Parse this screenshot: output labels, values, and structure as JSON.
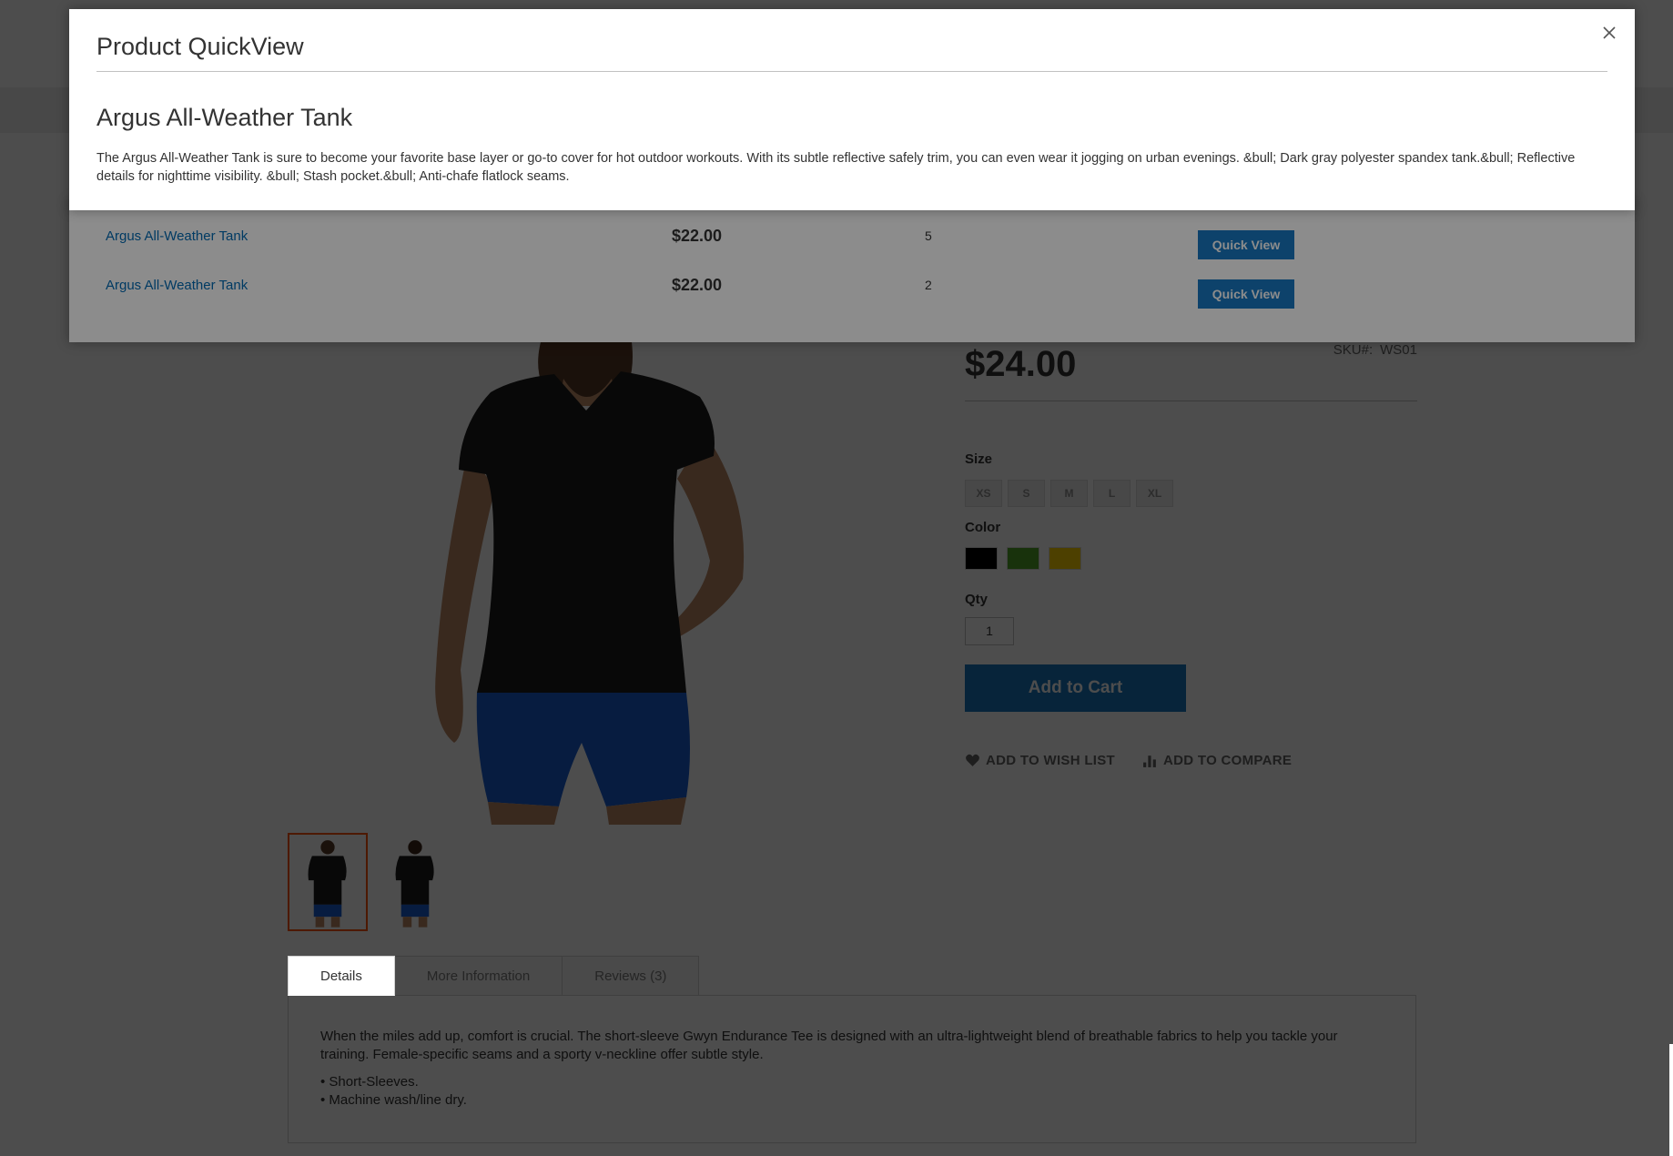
{
  "quickview": {
    "title": "Product QuickView",
    "product_name": "Argus All-Weather Tank",
    "description": "The Argus All-Weather Tank is sure to become your favorite base layer or go-to cover for hot outdoor workouts. With its subtle reflective safely trim, you can even wear it jogging on urban evenings. &bull; Dark gray polyester spandex tank.&bull; Reflective details for nighttime visibility. &bull; Stash pocket.&bull; Anti-chafe flatlock seams."
  },
  "related": {
    "rows": [
      {
        "name": "Argus All-Weather Tank",
        "price": "$22.00",
        "qty": "5",
        "button_label": "Quick View"
      },
      {
        "name": "Argus All-Weather Tank",
        "price": "$22.00",
        "qty": "2",
        "button_label": "Quick View"
      }
    ]
  },
  "product": {
    "price": "$24.00",
    "sku_label": "SKU#:",
    "sku_value": "WS01",
    "size_label": "Size",
    "sizes": [
      "XS",
      "S",
      "M",
      "L",
      "XL"
    ],
    "color_label": "Color",
    "colors": [
      "#000000",
      "#53a828",
      "#ffd500"
    ],
    "qty_label": "Qty",
    "qty_value": "1",
    "add_to_cart": "Add to Cart",
    "wish_list": "ADD TO WISH LIST",
    "compare": "ADD TO COMPARE"
  },
  "tabs": {
    "items": [
      "Details",
      "More Information",
      "Reviews (3)"
    ],
    "active": "Details",
    "details_paragraph": "When the miles add up, comfort is crucial. The short-sleeve Gwyn Endurance Tee is designed with an ultra-lightweight blend of breathable fabrics to help you tackle your training. Female-specific seams and a sporty v-neckline offer subtle style.",
    "bullets": [
      "• Short-Sleeves.",
      "• Machine wash/line dry."
    ]
  },
  "colors": {
    "accent": "#1979c3",
    "link": "#006bb4",
    "thumb_active_border": "#ff5501"
  }
}
